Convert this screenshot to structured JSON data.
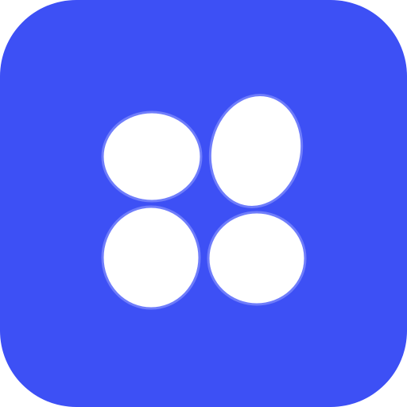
{
  "icon": {
    "name": "app-icon",
    "glyph": "four-dots-icon",
    "colors": {
      "background": "#3d50f5",
      "dot_fill": "#ffffff",
      "dot_outline": "#6f7dfb"
    }
  }
}
